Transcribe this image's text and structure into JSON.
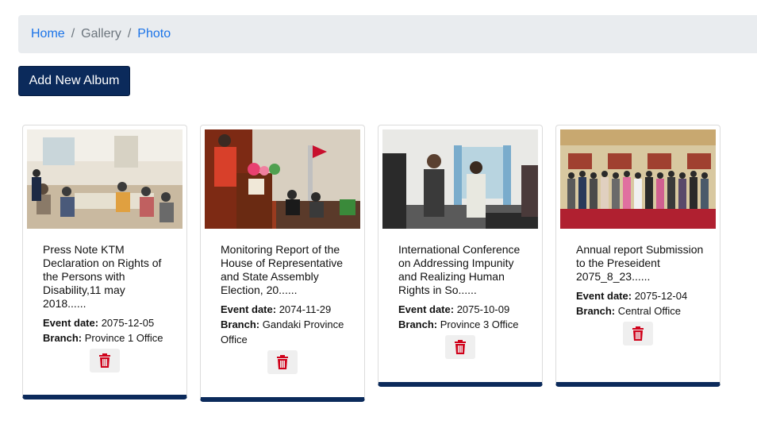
{
  "breadcrumb": {
    "home": "Home",
    "separator1": "/",
    "gallery": "Gallery",
    "separator2": "/",
    "photo": "Photo"
  },
  "actions": {
    "add_album": "Add New Album"
  },
  "labels": {
    "event_date": "Event date:",
    "branch": "Branch:"
  },
  "colors": {
    "navy": "#0b2a5b",
    "link": "#1a73e8",
    "delete": "#d0021b"
  },
  "cards": [
    {
      "title": "Press Note KTM Declaration on Rights of the Persons with Disability,11 may 2018......",
      "event_date": "2075-12-05",
      "branch": "Province 1 Office",
      "icon": "trash-icon"
    },
    {
      "title": "Monitoring Report of the House of Representative and State Assembly Election, 20......",
      "event_date": "2074-11-29",
      "branch": "Gandaki Province Office",
      "icon": "trash-icon"
    },
    {
      "title": "International Conference on Addressing Impunity and Realizing Human Rights in So......",
      "event_date": "2075-10-09",
      "branch": "Province 3 Office",
      "icon": "trash-icon"
    },
    {
      "title": "Annual report Submission to the Preseident 2075_8_23......",
      "event_date": "2075-12-04",
      "branch": "Central Office",
      "icon": "trash-icon"
    }
  ]
}
